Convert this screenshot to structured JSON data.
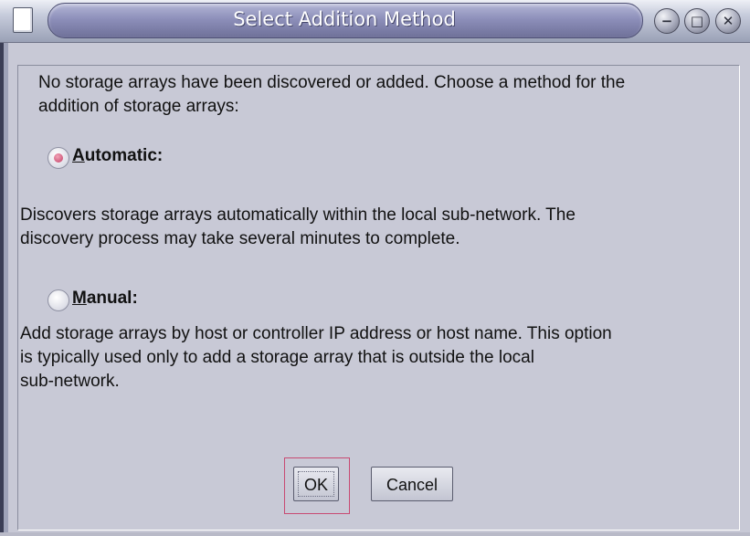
{
  "window": {
    "title": "Select Addition Method",
    "controls": {
      "minimize_icon": "minimize-icon",
      "maximize_icon": "maximize-icon",
      "close_icon": "close-icon"
    }
  },
  "dialog": {
    "intro_line1": "No storage arrays have been discovered or added. Choose a method for the",
    "intro_line2": "addition of storage arrays:",
    "options": [
      {
        "mnemonic": "A",
        "label_rest": "utomatic:",
        "selected": true,
        "description_lines": [
          "Discovers storage arrays automatically within the local sub-network. The",
          "discovery process may take several minutes to complete."
        ]
      },
      {
        "mnemonic": "M",
        "label_rest": "anual:",
        "selected": false,
        "description_lines": [
          "Add storage arrays by host or controller IP address or host name. This option",
          "is typically used only to add a storage array that is outside the local",
          "sub-network."
        ]
      }
    ],
    "buttons": {
      "ok_label": "OK",
      "cancel_label": "Cancel"
    }
  },
  "colors": {
    "background": "#c8c9d6",
    "title_bar": "#8d8fba",
    "radio_selected": "#c43c64",
    "focus_ring": "#c84a72"
  }
}
